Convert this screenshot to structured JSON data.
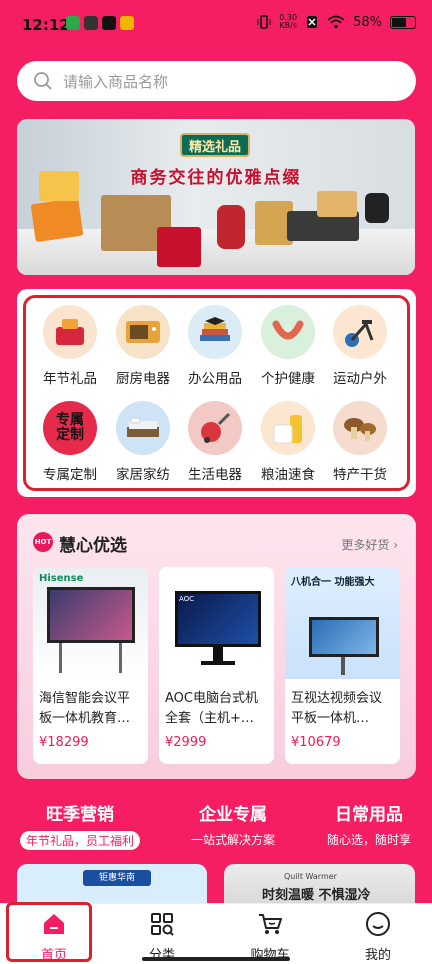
{
  "status": {
    "time": "12:12",
    "net_speed_value": "0.30",
    "net_speed_unit": "KB/s",
    "battery": "58%"
  },
  "search": {
    "placeholder": "请输入商品名称",
    "icon": "search-icon"
  },
  "banner": {
    "badge": "精选礼品",
    "slogan": "商务交往的优雅点缀"
  },
  "categories": [
    {
      "label": "年节礼品",
      "icon": "gift-basket-icon"
    },
    {
      "label": "厨房电器",
      "icon": "microwave-icon"
    },
    {
      "label": "办公用品",
      "icon": "books-icon"
    },
    {
      "label": "个护健康",
      "icon": "neck-massager-icon"
    },
    {
      "label": "运动户外",
      "icon": "exercise-bike-icon"
    },
    {
      "label": "专属定制",
      "icon": "custom-badge-icon",
      "icon_text": "专属\n定制"
    },
    {
      "label": "家居家纺",
      "icon": "bed-icon"
    },
    {
      "label": "生活电器",
      "icon": "vacuum-icon"
    },
    {
      "label": "粮油速食",
      "icon": "grain-oil-icon"
    },
    {
      "label": "特产干货",
      "icon": "mushroom-icon"
    }
  ],
  "huixin": {
    "title": "慧心优选",
    "logo": "HOT",
    "more": "更多好货",
    "products": [
      {
        "name": "海信智能会议平板一体机教育…",
        "price": "¥18299",
        "brand": "Hisense"
      },
      {
        "name": "AOC电脑台式机全套（主机+…",
        "price": "¥2999",
        "brand": "AOC"
      },
      {
        "name": "互视达视频会议平板一体机…",
        "price": "¥10679",
        "headline": "八机合一 功能强大"
      }
    ]
  },
  "strip": [
    {
      "title": "旺季营销",
      "sub": "年节礼品，员工福利"
    },
    {
      "title": "企业专属",
      "sub": "一站式解决方案"
    },
    {
      "title": "日常用品",
      "sub": "随心选，随时享"
    }
  ],
  "peek": {
    "left_text": "钜惠华南",
    "right_title": "时刻温暖 不惧湿冷",
    "right_sub": "Quilt Warmer"
  },
  "tabs": [
    {
      "label": "首页",
      "icon": "home-icon"
    },
    {
      "label": "分类",
      "icon": "category-icon"
    },
    {
      "label": "购物车",
      "icon": "cart-icon"
    },
    {
      "label": "我的",
      "icon": "smile-icon"
    }
  ],
  "colors": {
    "brand": "#f61e63",
    "highlight": "#d9212f"
  }
}
